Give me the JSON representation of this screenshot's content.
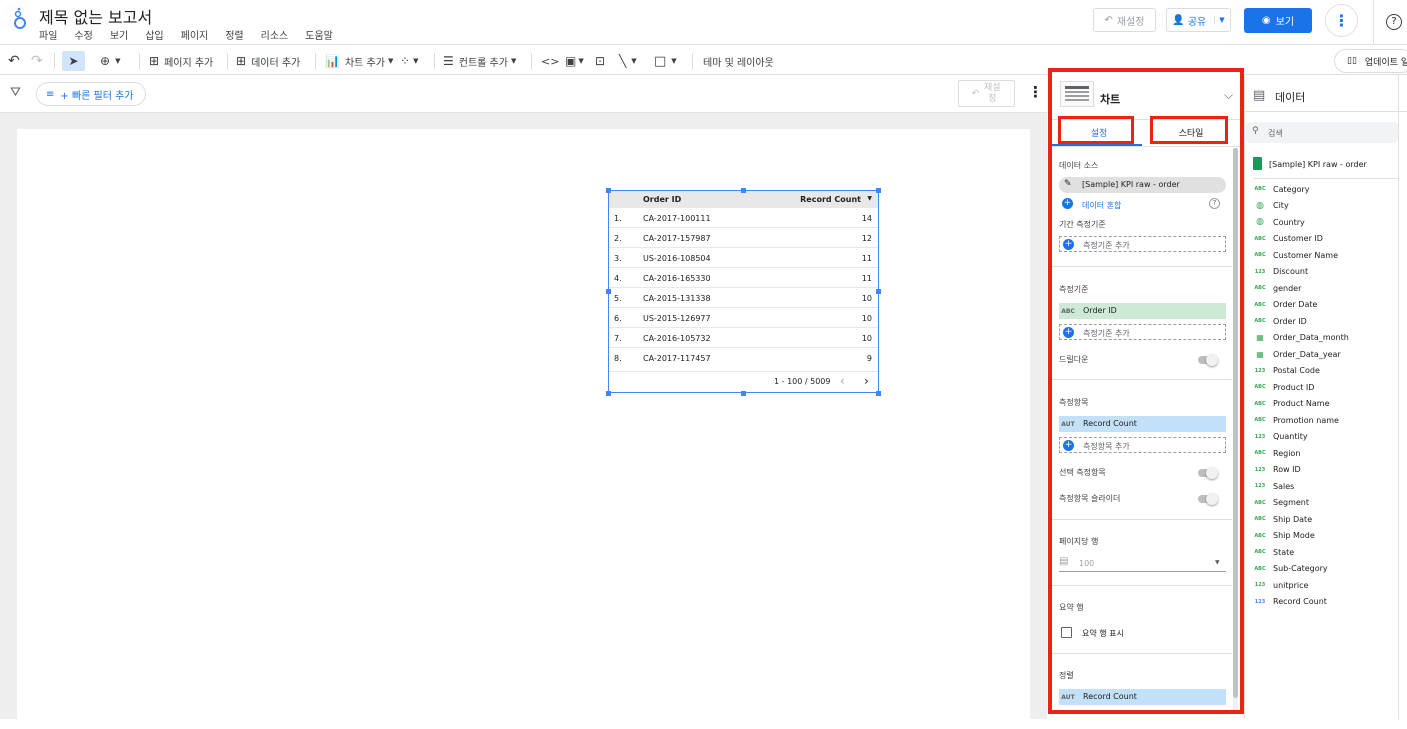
{
  "header": {
    "title": "제목 없는 보고서",
    "menu": [
      "파일",
      "수정",
      "보기",
      "삽입",
      "페이지",
      "정렬",
      "리소스",
      "도움말"
    ],
    "reset_label": "재설정",
    "share_label": "공유",
    "view_label": "보기"
  },
  "toolbar": {
    "add_page": "페이지 추가",
    "add_data": "데이터 추가",
    "add_chart": "차트 추가",
    "add_control": "컨트롤 추가",
    "theme_layout": "테마 및 레이아웃",
    "update_label": "업데이트 일"
  },
  "filterbar": {
    "quick_filter": "+ 빠른 필터 추가",
    "reset_label": "재설정"
  },
  "table": {
    "col1": "Order ID",
    "col2": "Record Count",
    "rows": [
      {
        "n": "1.",
        "id": "CA-2017-100111",
        "v": "14"
      },
      {
        "n": "2.",
        "id": "CA-2017-157987",
        "v": "12"
      },
      {
        "n": "3.",
        "id": "US-2016-108504",
        "v": "11"
      },
      {
        "n": "4.",
        "id": "CA-2016-165330",
        "v": "11"
      },
      {
        "n": "5.",
        "id": "CA-2015-131338",
        "v": "10"
      },
      {
        "n": "6.",
        "id": "US-2015-126977",
        "v": "10"
      },
      {
        "n": "7.",
        "id": "CA-2016-105732",
        "v": "10"
      },
      {
        "n": "8.",
        "id": "CA-2017-117457",
        "v": "9"
      }
    ],
    "pagination": "1 - 100 / 5009"
  },
  "props": {
    "chart_label": "차트",
    "tab_setup": "설정",
    "tab_style": "스타일",
    "data_source_label": "데이터 소스",
    "data_source_value": "[Sample] KPI raw - order",
    "blend_label": "데이터 혼합",
    "date_range_label": "기간 측정기준",
    "add_dimension": "측정기준 추가",
    "dimension_label": "측정기준",
    "dimension_value": "Order ID",
    "dimension_tag": "ABC",
    "drilldown_label": "드릴다운",
    "metric_label": "측정항목",
    "metric_value": "Record Count",
    "metric_tag": "AUT",
    "add_metric": "측정항목 추가",
    "optional_metrics": "선택 측정항목",
    "metric_slider": "측정항목 슬라이더",
    "rows_per_page_label": "페이지당 행",
    "rows_per_page_value": "100",
    "summary_row_label": "요약 행",
    "show_summary": "요약 행 표시",
    "sort_label": "정렬",
    "sort_value": "Record Count",
    "sort_tag": "AUT"
  },
  "datapanel": {
    "title": "데이터",
    "search_placeholder": "검색",
    "source": "[Sample] KPI raw - order",
    "fields": [
      {
        "type": "ABC",
        "name": "Category",
        "color": "#34a853"
      },
      {
        "type": "geo",
        "name": "City",
        "color": "#34a853"
      },
      {
        "type": "geo",
        "name": "Country",
        "color": "#34a853"
      },
      {
        "type": "ABC",
        "name": "Customer ID",
        "color": "#34a853"
      },
      {
        "type": "ABC",
        "name": "Customer Name",
        "color": "#34a853"
      },
      {
        "type": "123",
        "name": "Discount",
        "color": "#34a853"
      },
      {
        "type": "ABC",
        "name": "gender",
        "color": "#34a853"
      },
      {
        "type": "ABC",
        "name": "Order Date",
        "color": "#34a853"
      },
      {
        "type": "ABC",
        "name": "Order ID",
        "color": "#34a853"
      },
      {
        "type": "cal",
        "name": "Order_Data_month",
        "color": "#34a853"
      },
      {
        "type": "cal",
        "name": "Order_Data_year",
        "color": "#34a853"
      },
      {
        "type": "123",
        "name": "Postal Code",
        "color": "#34a853"
      },
      {
        "type": "ABC",
        "name": "Product ID",
        "color": "#34a853"
      },
      {
        "type": "ABC",
        "name": "Product Name",
        "color": "#34a853"
      },
      {
        "type": "ABC",
        "name": "Promotion name",
        "color": "#34a853"
      },
      {
        "type": "123",
        "name": "Quantity",
        "color": "#34a853"
      },
      {
        "type": "ABC",
        "name": "Region",
        "color": "#34a853"
      },
      {
        "type": "123",
        "name": "Row ID",
        "color": "#34a853"
      },
      {
        "type": "123",
        "name": "Sales",
        "color": "#34a853"
      },
      {
        "type": "ABC",
        "name": "Segment",
        "color": "#34a853"
      },
      {
        "type": "ABC",
        "name": "Ship Date",
        "color": "#34a853"
      },
      {
        "type": "ABC",
        "name": "Ship Mode",
        "color": "#34a853"
      },
      {
        "type": "ABC",
        "name": "State",
        "color": "#34a853"
      },
      {
        "type": "ABC",
        "name": "Sub-Category",
        "color": "#34a853"
      },
      {
        "type": "123",
        "name": "unitprice",
        "color": "#34a853"
      },
      {
        "type": "123",
        "name": "Record Count",
        "color": "#4285f4"
      }
    ]
  },
  "colors": {
    "accent": "#1a73e8",
    "highlight": "#ea2415",
    "dimension_bg": "#ceead6",
    "metric_bg": "#c2e0f8"
  }
}
